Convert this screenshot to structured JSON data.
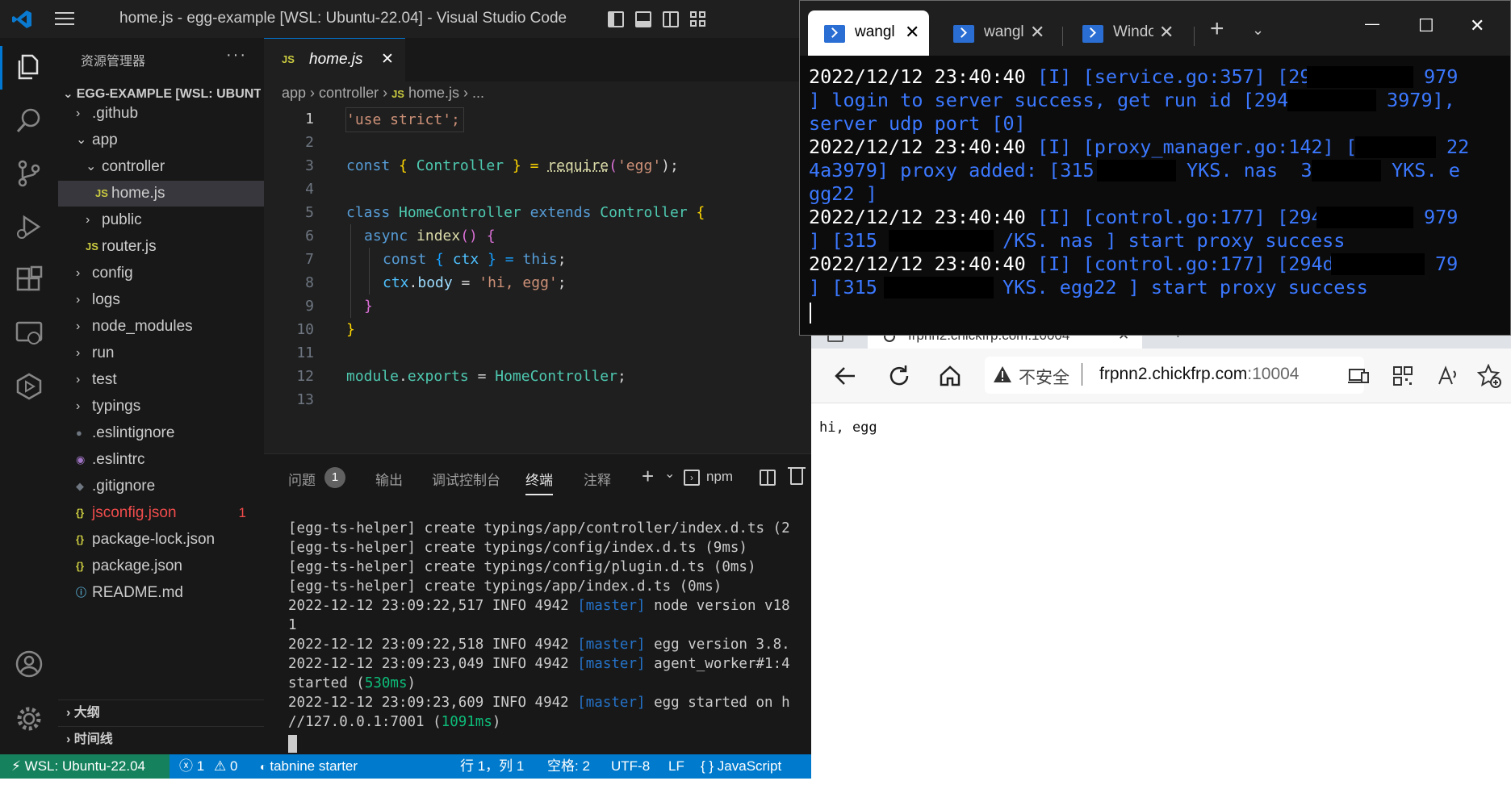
{
  "vscode": {
    "window_title": "home.js - egg-example [WSL: Ubuntu-22.04] - Visual Studio Code",
    "explorer": {
      "header": "资源管理器",
      "more": "···",
      "project": "EGG-EXAMPLE [WSL: UBUNTU-22.04]",
      "items": [
        {
          "label": ".github",
          "chev": "›",
          "icon": ""
        },
        {
          "label": "app",
          "chev": "⌄",
          "icon": ""
        },
        {
          "label": "controller",
          "chev": "⌄",
          "icon": ""
        },
        {
          "label": "home.js",
          "chev": "",
          "icon": "JS"
        },
        {
          "label": "public",
          "chev": "›",
          "icon": ""
        },
        {
          "label": "router.js",
          "chev": "",
          "icon": "JS"
        },
        {
          "label": "config",
          "chev": "›",
          "icon": ""
        },
        {
          "label": "logs",
          "chev": "›",
          "icon": ""
        },
        {
          "label": "node_modules",
          "chev": "›",
          "icon": ""
        },
        {
          "label": "run",
          "chev": "›",
          "icon": ""
        },
        {
          "label": "test",
          "chev": "›",
          "icon": ""
        },
        {
          "label": "typings",
          "chev": "›",
          "icon": ""
        },
        {
          "label": ".eslintignore",
          "chev": "",
          "icon": "●"
        },
        {
          "label": ".eslintrc",
          "chev": "",
          "icon": "◉"
        },
        {
          "label": ".gitignore",
          "chev": "",
          "icon": "◆"
        },
        {
          "label": "jsconfig.json",
          "chev": "",
          "icon": "{}",
          "badge": "1"
        },
        {
          "label": "package-lock.json",
          "chev": "",
          "icon": "{}"
        },
        {
          "label": "package.json",
          "chev": "",
          "icon": "{}"
        },
        {
          "label": "README.md",
          "chev": "",
          "icon": "ⓘ"
        }
      ],
      "outline": "大纲",
      "timeline": "时间线"
    },
    "editor_tab": {
      "icon": "JS",
      "label": "home.js",
      "close": "✕"
    },
    "breadcrumb": {
      "p1": "app",
      "p2": "controller",
      "icon": "JS",
      "p3": "home.js",
      "p4": "..."
    },
    "code_lines": [
      "1",
      "2",
      "3",
      "4",
      "5",
      "6",
      "7",
      "8",
      "9",
      "10",
      "11",
      "12",
      "13"
    ],
    "code": {
      "l1": "'use strict';",
      "l3a": "const",
      "l3b": " { ",
      "l3c": "Controller",
      "l3d": " } = ",
      "l3e": "require",
      "l3f": "(",
      "l3g": "'egg'",
      "l3h": ");",
      "l5a": "class",
      "l5b": " ",
      "l5c": "HomeController",
      "l5d": " extends ",
      "l5e": "Controller",
      "l5f": " {",
      "l6a": "async",
      "l6b": " ",
      "l6c": "index",
      "l6d": "() {",
      "l7a": "const",
      "l7b": " { ",
      "l7c": "ctx",
      "l7d": " } = ",
      "l7e": "this",
      "l7f": ";",
      "l8a": "ctx",
      "l8b": ".",
      "l8c": "body",
      "l8d": " = ",
      "l8e": "'hi, egg'",
      "l8f": ";",
      "l9": "}",
      "l10": "}",
      "l12a": "module",
      "l12b": ".",
      "l12c": "exports",
      "l12d": " = ",
      "l12e": "HomeController",
      "l12f": ";"
    },
    "panel": {
      "tabs": [
        "问题",
        "输出",
        "调试控制台",
        "终端",
        "注释"
      ],
      "problems_count": "1",
      "plus": "+",
      "chev": "⌄",
      "npm": "npm",
      "terminal_lines": [
        "[egg-ts-helper] create typings/app/controller/index.d.ts (2",
        "[egg-ts-helper] create typings/config/index.d.ts (9ms)",
        "[egg-ts-helper] create typings/config/plugin.d.ts (0ms)",
        "[egg-ts-helper] create typings/app/index.d.ts (0ms)"
      ],
      "log": {
        "l5a": "2022-12-12 23:09:22,517 INFO 4942 ",
        "l5b": "[master]",
        "l5c": " node version v18",
        "l6": "1",
        "l7a": "2022-12-12 23:09:22,518 INFO 4942 ",
        "l7b": "[master]",
        "l7c": " egg version 3.8.",
        "l8a": "2022-12-12 23:09:23,049 INFO 4942 ",
        "l8b": "[master]",
        "l8c": " agent_worker#1:4",
        "l9a": "started (",
        "l9b": "530ms",
        "l9c": ")",
        "l10a": "2022-12-12 23:09:23,609 INFO 4942 ",
        "l10b": "[master]",
        "l10c": " egg started on h",
        "l11a": "//127.0.0.1:7001 (",
        "l11b": "1091ms",
        "l11c": ")"
      }
    },
    "status": {
      "remote": "WSL: Ubuntu-22.04",
      "errors": "ⓧ 1",
      "warnings": "⚠ 0",
      "tabnine": "tabnine starter",
      "position": "行 1，列 1",
      "spaces": "空格: 2",
      "encoding": "UTF-8",
      "eol": "LF",
      "language": "{ } JavaScript"
    }
  },
  "terminal_window": {
    "tabs": [
      {
        "label": "wangl",
        "close": "✕"
      },
      {
        "label": "wangl",
        "close": "✕"
      },
      {
        "label": "Windo",
        "close": "✕"
      }
    ],
    "new_tab": "+",
    "dropdown": "⌄",
    "controls": {
      "min": "—",
      "max": "☐",
      "close": "✕"
    },
    "lines": {
      "a1": "2022/12/12 23:40:40 ",
      "a2": "[I] [service.go:357] [29",
      "a3": "979",
      "b1": "] login to server success, get run id [294d",
      "b2": "3979],",
      "c1": "server udp port [0]",
      "d1": "2022/12/12 23:40:40 ",
      "d2": "[I] [proxy_manager.go:142] [29",
      "d3": "22",
      "e1": "4a3979] proxy added: [315",
      "e2": "YKS. nas  31!",
      "e3": "YKS. e",
      "f1": "gg22 ]",
      "g1": "2022/12/12 23:40:40 ",
      "g2": "[I] [control.go:177] [294d",
      "g3": "979",
      "h1": "] [315",
      "h2": "/KS. nas ] start proxy success",
      "i1": "2022/12/12 23:40:40 ",
      "i2": "[I] [control.go:177] [294d",
      "i3": "79",
      "j1": "] [315",
      "j2": "YKS. egg22 ] start proxy success"
    }
  },
  "browser": {
    "tab_title": "frpnn2.chickfrp.com:10004",
    "tab_close": "✕",
    "new_tab": "+",
    "insecure_label": "不安全",
    "url_host": "frpnn2.chickfrp.com",
    "url_port": ":10004",
    "page_text": "hi, egg"
  }
}
